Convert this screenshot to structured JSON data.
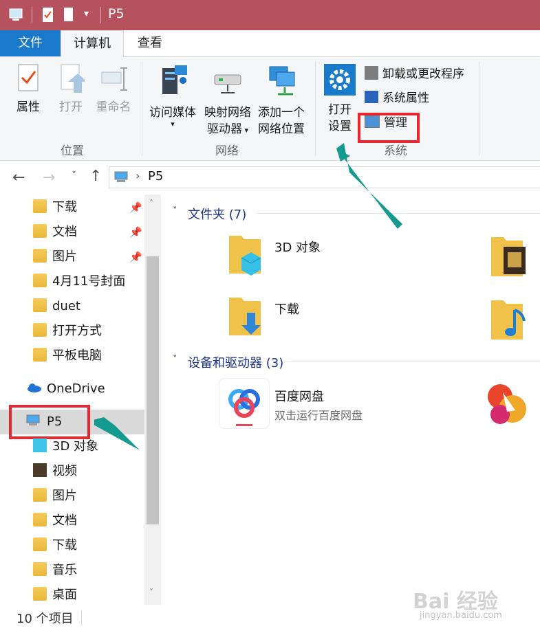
{
  "titlebar": {
    "title": "P5",
    "bg": "#b5525e"
  },
  "tabs": [
    {
      "label": "文件"
    },
    {
      "label": "计算机"
    },
    {
      "label": "查看"
    }
  ],
  "ribbon": {
    "location": {
      "label": "位置",
      "properties": "属性",
      "open": "打开",
      "rename": "重命名"
    },
    "network": {
      "label": "网络",
      "access_media": "访问媒体",
      "map_drive_1": "映射网络",
      "map_drive_2": "驱动器",
      "add_location_1": "添加一个",
      "add_location_2": "网络位置"
    },
    "system": {
      "label": "系统",
      "open_settings_1": "打开",
      "open_settings_2": "设置",
      "uninstall": "卸载或更改程序",
      "sys_props": "系统属性",
      "manage": "管理"
    }
  },
  "address": {
    "path": "P5"
  },
  "nav": {
    "quick": [
      {
        "label": "下载",
        "pinned": true,
        "icon": "download-folder-icon"
      },
      {
        "label": "文档",
        "pinned": true,
        "icon": "documents-folder-icon"
      },
      {
        "label": "图片",
        "pinned": true,
        "icon": "pictures-folder-icon"
      },
      {
        "label": "4月11号封面",
        "pinned": false,
        "icon": "folder-icon"
      },
      {
        "label": "duet",
        "pinned": false,
        "icon": "folder-icon"
      },
      {
        "label": "打开方式",
        "pinned": false,
        "icon": "folder-icon"
      },
      {
        "label": "平板电脑",
        "pinned": false,
        "icon": "folder-icon"
      }
    ],
    "onedrive": "OneDrive",
    "this_pc": "P5",
    "pc_children": [
      {
        "label": "3D 对象",
        "icon": "3d-objects-icon"
      },
      {
        "label": "视频",
        "icon": "videos-icon"
      },
      {
        "label": "图片",
        "icon": "pictures-folder-icon"
      },
      {
        "label": "文档",
        "icon": "documents-folder-icon"
      },
      {
        "label": "下载",
        "icon": "download-folder-icon"
      },
      {
        "label": "音乐",
        "icon": "music-folder-icon"
      },
      {
        "label": "桌面",
        "icon": "desktop-folder-icon"
      }
    ]
  },
  "main": {
    "folders_header": "文件夹 (7)",
    "folders": [
      {
        "label": "3D 对象"
      },
      {
        "label": "下载"
      }
    ],
    "devices_header": "设备和驱动器 (3)",
    "devices": [
      {
        "label": "百度网盘",
        "sub": "双击运行百度网盘"
      }
    ]
  },
  "status": {
    "count": "10 个项目"
  },
  "watermark": {
    "text": "Bai 经验",
    "sub": "jingyan.baidu.com"
  },
  "colors": {
    "accent": "#1979ca",
    "highlight_box": "#e8282e",
    "arrow": "#159a8f"
  }
}
